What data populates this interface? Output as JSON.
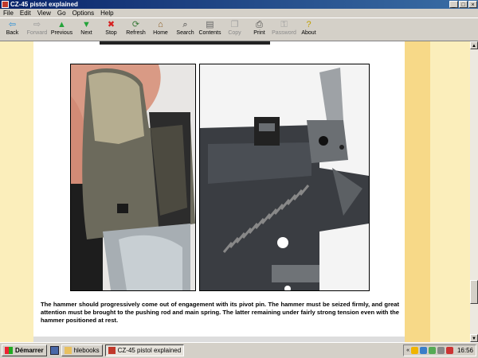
{
  "window": {
    "title": "CZ-45 pistol explained"
  },
  "menu": [
    "File",
    "Edit",
    "View",
    "Go",
    "Options",
    "Help"
  ],
  "toolbar": [
    {
      "label": "Back",
      "icon": "back-arrow-icon",
      "glyph": "⇦",
      "color": "#2a8fd6",
      "enabled": true
    },
    {
      "label": "Forward",
      "icon": "forward-arrow-icon",
      "glyph": "⇨",
      "color": "#9a9a9a",
      "enabled": false
    },
    {
      "label": "Previous",
      "icon": "up-arrow-icon",
      "glyph": "▲",
      "color": "#24a33a",
      "enabled": true
    },
    {
      "label": "Next",
      "icon": "down-arrow-icon",
      "glyph": "▼",
      "color": "#24a33a",
      "enabled": true
    },
    {
      "label": "Stop",
      "icon": "stop-icon",
      "glyph": "✖",
      "color": "#d62020",
      "enabled": true
    },
    {
      "label": "Refresh",
      "icon": "refresh-icon",
      "glyph": "⟳",
      "color": "#3a7a3a",
      "enabled": true
    },
    {
      "label": "Home",
      "icon": "home-icon",
      "glyph": "⌂",
      "color": "#8a5a20",
      "enabled": true
    },
    {
      "label": "Search",
      "icon": "search-icon",
      "glyph": "⌕",
      "color": "#333333",
      "enabled": true
    },
    {
      "label": "Contents",
      "icon": "contents-icon",
      "glyph": "▤",
      "color": "#666666",
      "enabled": true
    },
    {
      "label": "Copy",
      "icon": "copy-icon",
      "glyph": "❐",
      "color": "#a0a0a0",
      "enabled": false
    },
    {
      "label": "Print",
      "icon": "print-icon",
      "glyph": "⎙",
      "color": "#444444",
      "enabled": true
    },
    {
      "label": "Password",
      "icon": "key-icon",
      "glyph": "⚿",
      "color": "#a0a0a0",
      "enabled": false
    },
    {
      "label": "About",
      "icon": "about-icon",
      "glyph": "?",
      "color": "#c0a000",
      "enabled": true
    }
  ],
  "caption": "The hammer should progressively come out of engagement with its pivot pin. The hammer must be seized firmly, and great attention must be brought to the pushing rod and main spring. The latter remaining under fairly strong tension even with the hammer positioned at rest.",
  "taskbar": {
    "start": "Démarrer",
    "buttons": [
      {
        "label": "hlebooks",
        "active": false
      },
      {
        "label": "CZ-45 pistol explained",
        "active": true
      }
    ],
    "clock": "16:56"
  },
  "colors": {
    "titlebar": "#0a246a",
    "page_bg": "#fbeebb",
    "sidebar_stripe": "#f7d988"
  }
}
